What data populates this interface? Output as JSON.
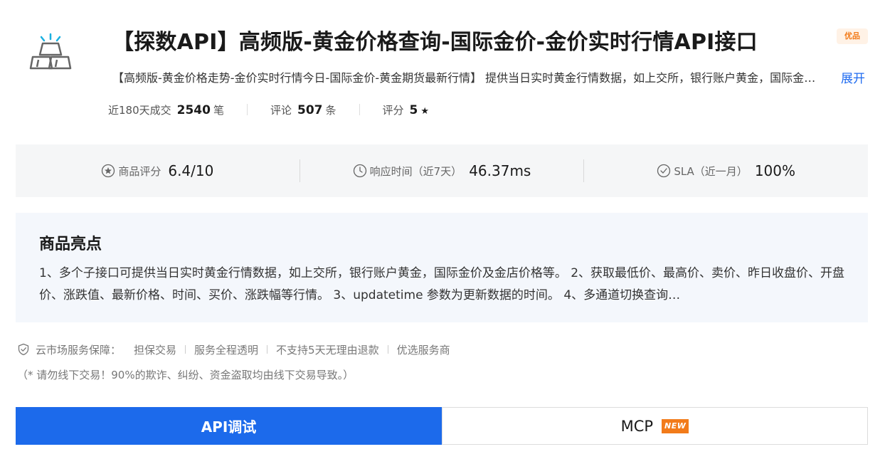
{
  "product": {
    "logo_icon": "gold-bars-icon",
    "title": "【探数API】高频版-黄金价格查询-国际金价-金价实时行情API接口",
    "premium_badge": "优品",
    "description": "【高频版-黄金价格走势-金价实时行情今日-国际金价-黄金期货最新行情】 提供当日实时黄金行情数据，如上交所，银行账户黄金，国际金价及金店价格等。",
    "expand_label": "展开"
  },
  "stats": [
    {
      "label": "近180天成交",
      "value": "2540",
      "unit": "笔"
    },
    {
      "label": "评论",
      "value": "507",
      "unit": "条"
    },
    {
      "label": "评分",
      "value": "5",
      "unit": "★"
    }
  ],
  "metrics": [
    {
      "icon": "star-circle-icon",
      "label": "商品评分",
      "value": "6.4/10"
    },
    {
      "icon": "clock-icon",
      "label": "响应时间（近7天）",
      "value": "46.37ms"
    },
    {
      "icon": "check-circle-icon",
      "label": "SLA（近一月）",
      "value": "100%"
    }
  ],
  "highlights": {
    "title": "商品亮点",
    "text": "1、多个子接口可提供当日实时黄金行情数据，如上交所，银行账户黄金，国际金价及金店价格等。 2、获取最低价、最高价、卖价、昨日收盘价、开盘价、涨跌值、最新价格、时间、买价、涨跌幅等行情。 3、updatetime 参数为更新数据的时间。 4、多通道切换查询…"
  },
  "guarantee": {
    "icon": "shield-check-icon",
    "label": "云市场服务保障：",
    "items": [
      "担保交易",
      "服务全程透明",
      "不支持5天无理由退款",
      "优选服务商"
    ]
  },
  "warning": "（* 请勿线下交易！90%的欺诈、纠纷、资金盗取均由线下交易导致。）",
  "tabs": {
    "api_label": "API调试",
    "mcp_label": "MCP",
    "mcp_badge": "NEW"
  },
  "colors": {
    "accent": "#1c6aeb",
    "badge_orange": "#f27b1a",
    "logo_cyan": "#1ab0e0"
  }
}
